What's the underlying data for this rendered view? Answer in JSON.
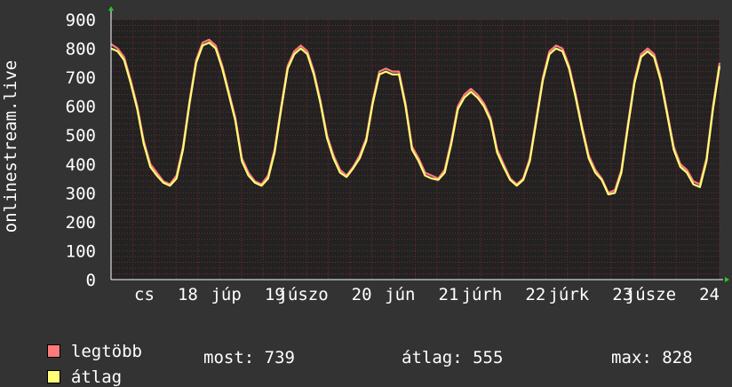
{
  "chart_data": {
    "type": "line",
    "ylabel": "onlinestream.live",
    "ylim": [
      0,
      900
    ],
    "y_ticks": [
      "0",
      "100",
      "200",
      "300",
      "400",
      "500",
      "600",
      "700",
      "800",
      "900"
    ],
    "x_tick_labels": [
      "cs",
      "18",
      "júp",
      "19",
      "júszo",
      "20",
      "jún",
      "21",
      "júrh",
      "22",
      "júrk",
      "23",
      "júsze",
      "24"
    ],
    "grid": true,
    "colors": {
      "background": "#333333",
      "plot": "#222222",
      "grid": "#7a2a2a",
      "axis": "#ffffff",
      "arrow": "#22cc22"
    },
    "series": [
      {
        "name": "legtöbb",
        "color": "#ff7a7a",
        "values": [
          815,
          800,
          770,
          690,
          600,
          480,
          400,
          370,
          340,
          330,
          360,
          460,
          620,
          760,
          820,
          830,
          810,
          740,
          650,
          560,
          420,
          370,
          340,
          330,
          360,
          450,
          600,
          740,
          790,
          810,
          790,
          720,
          620,
          500,
          430,
          380,
          360,
          390,
          430,
          490,
          620,
          720,
          730,
          720,
          720,
          610,
          460,
          420,
          370,
          360,
          350,
          380,
          480,
          600,
          640,
          660,
          640,
          610,
          560,
          450,
          400,
          350,
          330,
          350,
          420,
          560,
          700,
          790,
          810,
          800,
          740,
          640,
          530,
          430,
          380,
          350,
          300,
          310,
          380,
          540,
          690,
          780,
          800,
          780,
          700,
          580,
          460,
          400,
          380,
          340,
          330,
          420,
          600,
          750
        ]
      },
      {
        "name": "átlag",
        "color": "#ffff77",
        "values": [
          800,
          790,
          760,
          680,
          590,
          470,
          390,
          360,
          335,
          325,
          350,
          450,
          610,
          750,
          810,
          820,
          800,
          730,
          640,
          550,
          410,
          360,
          335,
          325,
          350,
          440,
          590,
          730,
          780,
          800,
          780,
          710,
          610,
          490,
          420,
          370,
          355,
          385,
          420,
          480,
          610,
          710,
          720,
          710,
          710,
          600,
          450,
          410,
          360,
          350,
          345,
          370,
          470,
          590,
          630,
          650,
          630,
          600,
          550,
          440,
          390,
          345,
          325,
          345,
          410,
          550,
          690,
          780,
          800,
          790,
          730,
          630,
          520,
          420,
          370,
          345,
          295,
          300,
          370,
          530,
          680,
          770,
          790,
          770,
          690,
          570,
          450,
          390,
          370,
          330,
          320,
          410,
          590,
          739
        ]
      }
    ]
  },
  "legend": {
    "items": [
      {
        "label": "legtöbb",
        "color": "#ff7a7a"
      },
      {
        "label": "átlag",
        "color": "#ffff77"
      }
    ]
  },
  "stats": {
    "most": "most: 739",
    "atlag": "átlag: 555",
    "max": "max: 828"
  }
}
